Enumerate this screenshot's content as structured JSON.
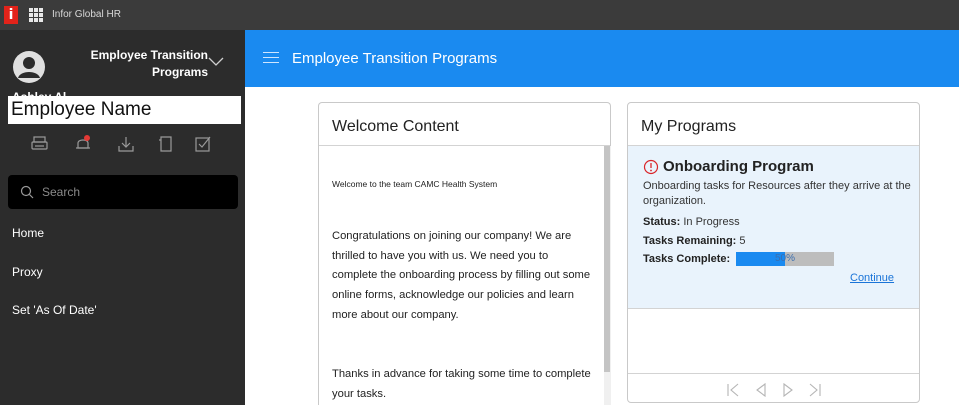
{
  "topbar": {
    "app_name": "Infor Global HR",
    "logo_text": "i"
  },
  "sidebar": {
    "title_line1": "Employee Transition",
    "title_line2": "Programs",
    "employee_name": "Employee Name",
    "ghost_text": "Ashley Al",
    "search_placeholder": "Search",
    "nav": [
      {
        "label": "Home"
      },
      {
        "label": "Proxy"
      },
      {
        "label": "Set 'As Of Date'"
      }
    ]
  },
  "header": {
    "title": "Employee Transition Programs"
  },
  "welcome": {
    "title": "Welcome Content",
    "small_text": "Welcome to the team CAMC Health System",
    "body": "Congratulations on joining our company! We are thrilled to have you with us. We need you to complete the onboarding process by filling out some online forms, acknowledge our policies and learn more about our company.",
    "body2": "Thanks in advance for taking some time to complete your tasks."
  },
  "programs": {
    "title": "My Programs",
    "program_title": "Onboarding Program",
    "program_desc": "Onboarding tasks for Resources after they arrive at the organization.",
    "status_label": "Status:",
    "status_value": "In Progress",
    "remaining_label": "Tasks Remaining:",
    "remaining_value": "5",
    "complete_label": "Tasks Complete:",
    "progress_text": "50%",
    "progress_fraction": 0.5,
    "continue_label": "Continue"
  },
  "colors": {
    "accent": "#1a8af0",
    "sidebar": "#2c2c2c",
    "topbar": "#3b3b3b",
    "logo": "#e2231a",
    "alert": "#d9262b"
  }
}
